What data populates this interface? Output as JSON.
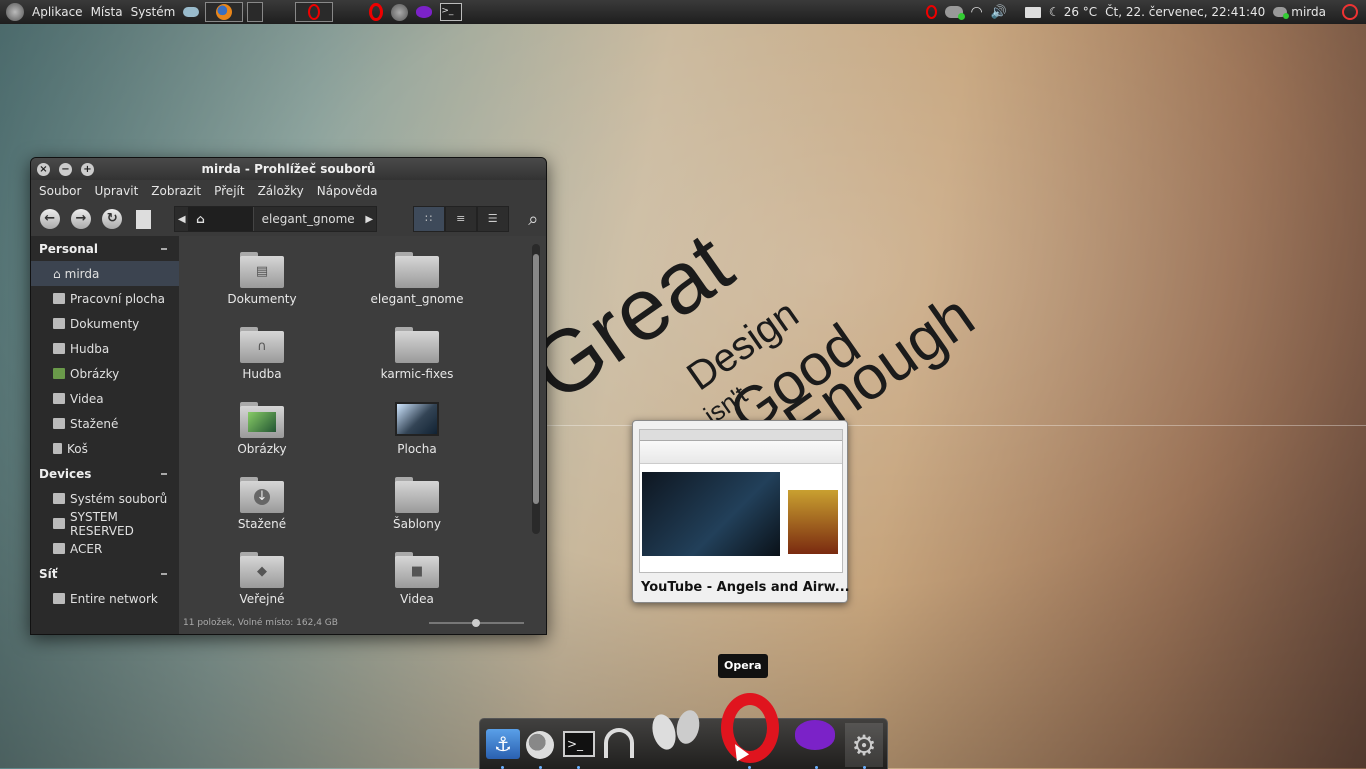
{
  "top_panel": {
    "menu": [
      "Aplikace",
      "Místa",
      "Systém"
    ],
    "tasks": [
      "firefox",
      "blank",
      "opera"
    ],
    "launchers": [
      "opera-icon",
      "firefox-icon",
      "pidgin-icon",
      "terminal-icon"
    ],
    "indicators": [
      "opera-icon",
      "network-icon",
      "wifi-icon",
      "volume-icon",
      "mail-icon"
    ],
    "weather": "26 °C",
    "clock": "Čt, 22. červenec, 22:41:40",
    "user": "mirda"
  },
  "wallpaper": {
    "words": [
      "Great",
      "Design",
      "isn't",
      "Good",
      "Enough"
    ]
  },
  "window": {
    "title": "mirda - Prohlížeč souborů",
    "menu": [
      "Soubor",
      "Upravit",
      "Zobrazit",
      "Přejít",
      "Záložky",
      "Nápověda"
    ],
    "path": {
      "current": "mirda",
      "next": "elegant_gnome"
    },
    "sidebar": {
      "personal": {
        "title": "Personal",
        "items": [
          "mirda",
          "Pracovní plocha",
          "Dokumenty",
          "Hudba",
          "Obrázky",
          "Videa",
          "Stažené",
          "Koš"
        ]
      },
      "devices": {
        "title": "Devices",
        "items": [
          "Systém souborů",
          "SYSTEM RESERVED",
          "ACER"
        ]
      },
      "network": {
        "title": "Síť",
        "items": [
          "Entire network"
        ]
      }
    },
    "files": [
      "Dokumenty",
      "elegant_gnome",
      "Hudba",
      "karmic-fixes",
      "Obrázky",
      "Plocha",
      "Stažené",
      "Šablony",
      "Veřejné",
      "Videa"
    ],
    "status": "11 položek, Volné místo: 162,4 GB"
  },
  "preview": {
    "title": "YouTube - Angels and Airw..."
  },
  "tooltip": "Opera",
  "dock": [
    "anchor-icon",
    "firefox-icon",
    "terminal-icon",
    "headphones-icon",
    "feet-icon",
    "opera-icon",
    "pidgin-icon",
    "gear-icon"
  ]
}
